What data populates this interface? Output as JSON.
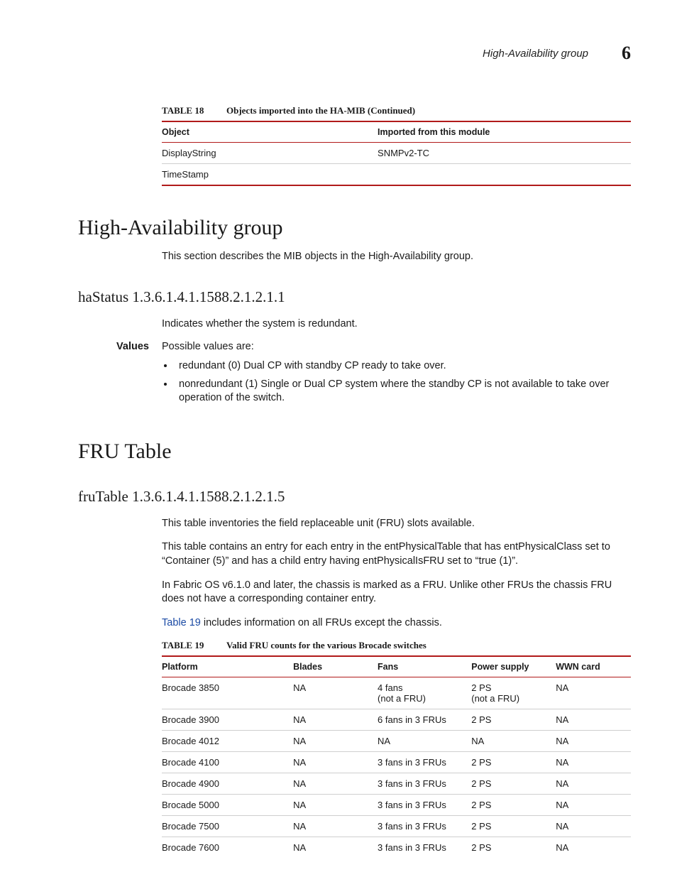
{
  "header": {
    "title": "High-Availability group",
    "chapter": "6"
  },
  "table18": {
    "label": "TABLE 18",
    "caption": "Objects imported into the HA-MIB  (Continued)",
    "headers": [
      "Object",
      "Imported from this module"
    ],
    "rows": [
      [
        "DisplayString",
        "SNMPv2-TC"
      ],
      [
        "TimeStamp",
        ""
      ]
    ]
  },
  "sectionHA": {
    "heading": "High-Availability group",
    "intro": "This section describes the MIB objects in the High-Availability group."
  },
  "haStatus": {
    "heading": "haStatus 1.3.6.1.4.1.1588.2.1.2.1.1",
    "desc": "Indicates whether the system is redundant.",
    "valuesLabel": "Values",
    "valuesIntro": "Possible values are:",
    "bullets": [
      "redundant (0) Dual CP with standby CP ready to take over.",
      "nonredundant (1) Single or Dual CP system where the standby CP is not available to take over operation of the switch."
    ]
  },
  "sectionFRU": {
    "heading": "FRU Table"
  },
  "fruTable": {
    "heading": "fruTable 1.3.6.1.4.1.1588.2.1.2.1.5",
    "p1": "This table inventories the field replaceable unit (FRU) slots available.",
    "p2": "This table contains an entry for each entry in the entPhysicalTable that has entPhysicalClass set to “Container (5)” and has a child entry having entPhysicalIsFRU set to “true (1)”.",
    "p3": "In Fabric OS v6.1.0 and later, the chassis is marked as a FRU. Unlike other FRUs the chassis FRU does not have a corresponding container entry.",
    "p4_link": "Table 19",
    "p4_rest": " includes information on all FRUs except the chassis."
  },
  "table19": {
    "label": "TABLE 19",
    "caption": "Valid FRU counts for the various Brocade switches",
    "headers": [
      "Platform",
      "Blades",
      "Fans",
      "Power supply",
      "WWN card"
    ],
    "rows": [
      [
        "Brocade 3850",
        "NA",
        "4 fans\n(not a FRU)",
        "2 PS\n(not a FRU)",
        "NA"
      ],
      [
        "Brocade 3900",
        "NA",
        "6 fans in 3 FRUs",
        "2 PS",
        "NA"
      ],
      [
        "Brocade 4012",
        "NA",
        "NA",
        "NA",
        "NA"
      ],
      [
        "Brocade 4100",
        "NA",
        "3 fans in 3 FRUs",
        "2 PS",
        "NA"
      ],
      [
        "Brocade 4900",
        "NA",
        "3 fans in 3 FRUs",
        "2 PS",
        "NA"
      ],
      [
        "Brocade 5000",
        "NA",
        "3 fans in 3 FRUs",
        "2 PS",
        "NA"
      ],
      [
        "Brocade 7500",
        "NA",
        "3 fans in 3 FRUs",
        "2 PS",
        "NA"
      ],
      [
        "Brocade 7600",
        "NA",
        "3 fans in 3 FRUs",
        "2 PS",
        "NA"
      ]
    ]
  }
}
